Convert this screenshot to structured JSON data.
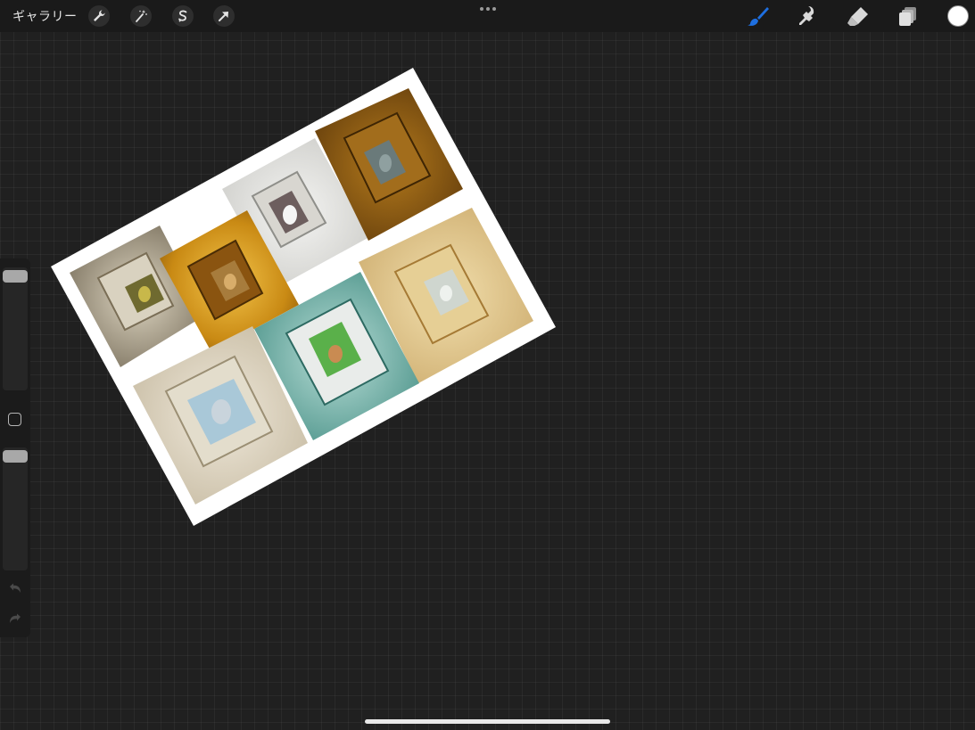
{
  "topbar": {
    "gallery_label": "ギャラリー",
    "tools_left": [
      "wrench-icon",
      "magic-wand-icon",
      "selection-s-icon",
      "transform-arrow-icon"
    ],
    "tools_right": [
      "brush-icon",
      "smudge-icon",
      "eraser-icon",
      "layers-icon"
    ],
    "active_tool": "brush-icon",
    "active_color": "#1e6fe0",
    "current_color": "#ffffff"
  },
  "sidebar": {
    "brush_size_level": 1.0,
    "opacity_level": 1.0
  },
  "canvas": {
    "background": "#202020",
    "artwork": "photo-collage-cat-paintings-in-ornate-frames"
  }
}
